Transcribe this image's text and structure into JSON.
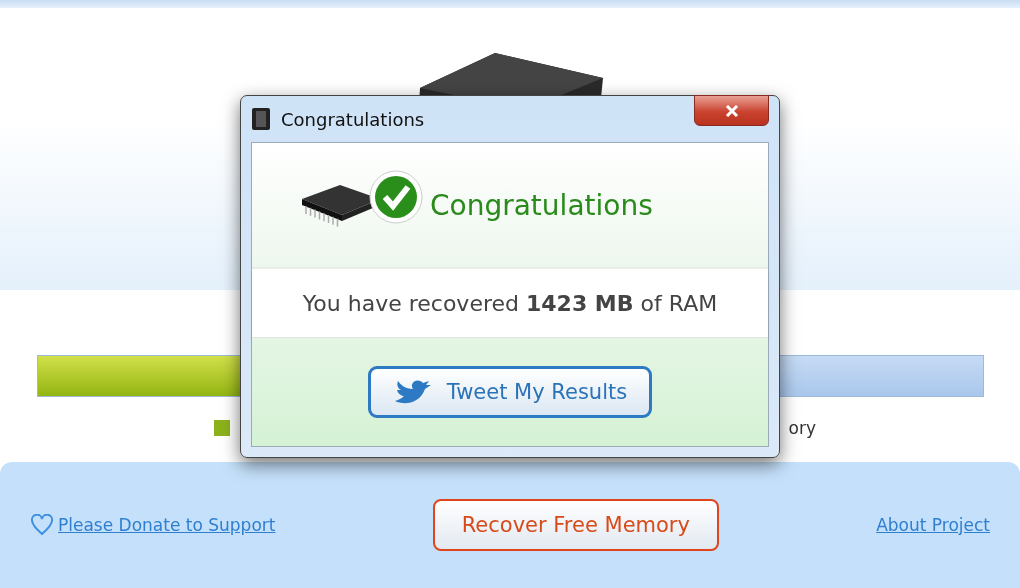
{
  "memory_bar": {
    "level": 0.5
  },
  "legend": {
    "visible_text": "ory"
  },
  "footer": {
    "donate_link": "Please Donate to Support",
    "recover_button": "Recover Free Memory",
    "about_link": "About Project"
  },
  "dialog": {
    "title": "Congratulations",
    "heading": "Congratulations",
    "message": "You have recovered **1423 MB** of RAM",
    "tweet_button": "Tweet My Results"
  }
}
